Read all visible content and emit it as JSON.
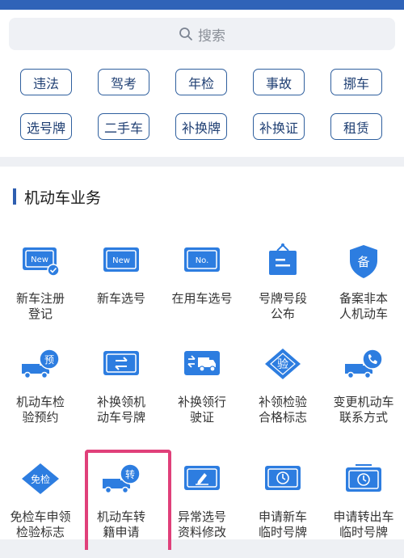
{
  "search": {
    "placeholder": "搜索"
  },
  "tags": [
    "违法",
    "驾考",
    "年检",
    "事故",
    "挪车",
    "选号牌",
    "二手车",
    "补换牌",
    "补换证",
    "租赁"
  ],
  "section": {
    "title": "机动车业务",
    "items": [
      {
        "line1": "新车注册",
        "line2": "登记",
        "icon": "new-plate-check-icon"
      },
      {
        "line1": "新车选号",
        "line2": "",
        "icon": "new-plate-icon"
      },
      {
        "line1": "在用车选号",
        "line2": "",
        "icon": "number-plate-icon"
      },
      {
        "line1": "号牌号段",
        "line2": "公布",
        "icon": "notice-board-icon"
      },
      {
        "line1": "备案非本",
        "line2": "人机动车",
        "icon": "shield-record-icon"
      },
      {
        "line1": "机动车检",
        "line2": "验预约",
        "icon": "truck-reserve-icon"
      },
      {
        "line1": "补换领机",
        "line2": "动车号牌",
        "icon": "plate-exchange-icon"
      },
      {
        "line1": "补换领行",
        "line2": "驶证",
        "icon": "license-truck-icon"
      },
      {
        "line1": "补领检验",
        "line2": "合格标志",
        "icon": "inspection-badge-icon"
      },
      {
        "line1": "变更机动车",
        "line2": "联系方式",
        "icon": "truck-phone-icon"
      },
      {
        "line1": "免检车申领",
        "line2": "检验标志",
        "icon": "exempt-badge-icon"
      },
      {
        "line1": "机动车转",
        "line2": "籍申请",
        "icon": "truck-transfer-icon"
      },
      {
        "line1": "异常选号",
        "line2": "资料修改",
        "icon": "edit-card-icon"
      },
      {
        "line1": "申请新车",
        "line2": "临时号牌",
        "icon": "temp-plate-clock-icon"
      },
      {
        "line1": "申请转出车",
        "line2": "临时号牌",
        "icon": "temp-plate-radio-icon"
      }
    ]
  }
}
